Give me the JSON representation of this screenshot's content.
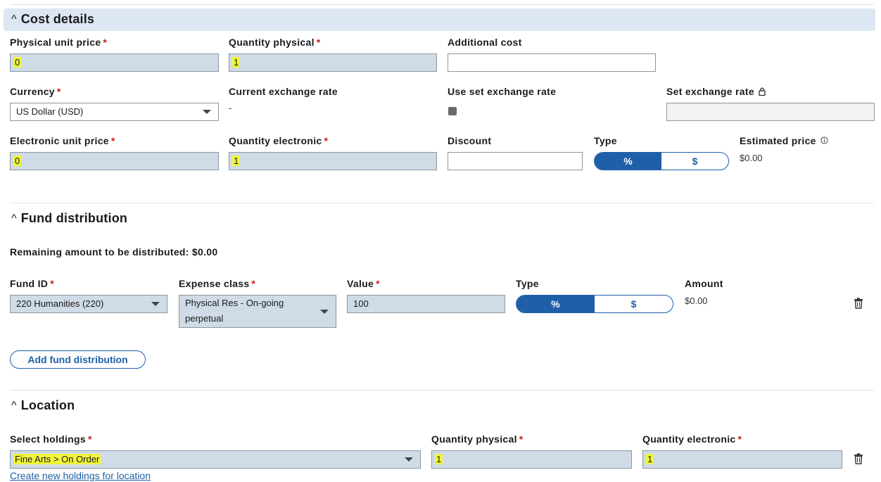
{
  "cost_details": {
    "title": "Cost details",
    "physical_unit_price": {
      "label": "Physical unit price",
      "value": "0"
    },
    "quantity_physical": {
      "label": "Quantity physical",
      "value": "1"
    },
    "additional_cost": {
      "label": "Additional cost",
      "value": ""
    },
    "currency": {
      "label": "Currency",
      "value": "US Dollar (USD)"
    },
    "current_exchange_rate": {
      "label": "Current exchange rate",
      "value": "-"
    },
    "use_set_exchange_rate": {
      "label": "Use set exchange rate"
    },
    "set_exchange_rate": {
      "label": "Set exchange rate",
      "value": ""
    },
    "electronic_unit_price": {
      "label": "Electronic unit price",
      "value": "0"
    },
    "quantity_electronic": {
      "label": "Quantity electronic",
      "value": "1"
    },
    "discount": {
      "label": "Discount",
      "value": ""
    },
    "type": {
      "label": "Type",
      "options": [
        "%",
        "$"
      ],
      "selected": "%"
    },
    "estimated_price": {
      "label": "Estimated price",
      "value": "$0.00"
    }
  },
  "fund_distribution": {
    "title": "Fund distribution",
    "remaining": "Remaining amount to be distributed: $0.00",
    "fund_id": {
      "label": "Fund ID",
      "value": "220 Humanities (220)"
    },
    "expense_class": {
      "label": "Expense class",
      "value": "Physical Res - On-going perpetual"
    },
    "value": {
      "label": "Value",
      "value": "100"
    },
    "type": {
      "label": "Type",
      "options": [
        "%",
        "$"
      ],
      "selected": "%"
    },
    "amount": {
      "label": "Amount",
      "value": "$0.00"
    },
    "add_button": "Add fund distribution"
  },
  "location": {
    "title": "Location",
    "select_holdings": {
      "label": "Select holdings",
      "value": "Fine Arts > On Order"
    },
    "quantity_physical": {
      "label": "Quantity physical",
      "value": "1"
    },
    "quantity_electronic": {
      "label": "Quantity electronic",
      "value": "1"
    },
    "create_link": "Create new holdings for location"
  },
  "icons": {
    "collapse": "chevron-up-icon",
    "lock": "lock-icon",
    "info": "info-icon",
    "delete": "trash-icon",
    "dropdown": "caret-down-icon"
  },
  "colors": {
    "accent": "#1f5fa8",
    "required": "#c81e1e",
    "highlight": "#f0f53a",
    "section_bar": "#dde7f3",
    "input_bg": "#cfdbe7"
  }
}
